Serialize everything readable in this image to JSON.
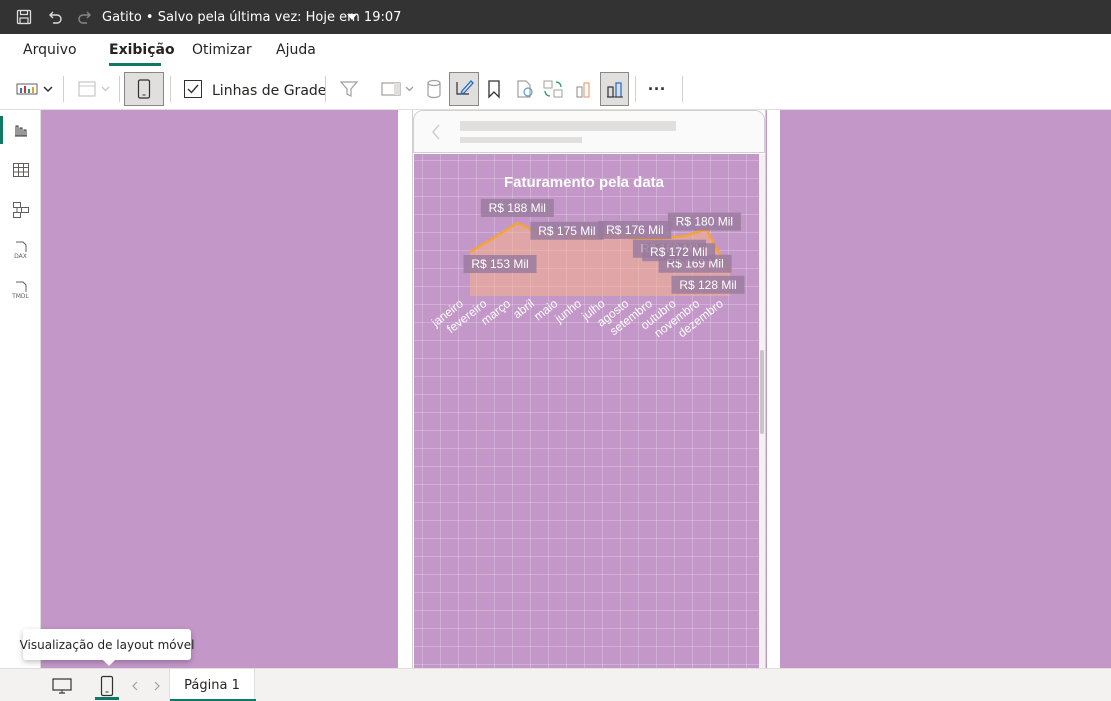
{
  "titlebar": {
    "title": "Gatito • Salvo pela última vez: Hoje em 19:07",
    "icons": [
      "save-icon",
      "undo-icon",
      "redo-icon",
      "dropdown-caret-icon"
    ]
  },
  "menu": {
    "items": [
      "Arquivo",
      "Exibição",
      "Otimizar",
      "Ajuda"
    ],
    "active": "Exibição"
  },
  "toolbar": {
    "gridlines_label": "Linhas de Grade",
    "gridlines_checked": true,
    "more_label": "···"
  },
  "left_rail": {
    "items": [
      "report-view-icon",
      "table-view-icon",
      "model-view-icon",
      "dax-query-icon",
      "tmdl-view-icon"
    ],
    "dax_label": "DAX",
    "tmdl_label": "TMDL"
  },
  "bottombar": {
    "page_tab": "Página 1",
    "tooltip": "Visualização de layout móvel"
  },
  "colors": {
    "canvas": "#c497c9",
    "accent": "#117865",
    "line": "#f2a33a",
    "area": "#f7b38a",
    "label_bg": "#9a7b9e"
  },
  "chart_data": {
    "type": "area",
    "title": "Faturamento pela data",
    "categories": [
      "janeiro",
      "fevereiro",
      "março",
      "abril",
      "maio",
      "junho",
      "julho",
      "agosto",
      "setembro",
      "outubro",
      "novembro",
      "dezembro"
    ],
    "series": [
      {
        "values": [
          153,
          170,
          188,
          175,
          176,
          169,
          176,
          169,
          169,
          172,
          180,
          128
        ],
        "labels": [
          "R$ 153 Mil",
          null,
          "R$ 188 Mil",
          "R$ 175 Mil",
          null,
          null,
          "R$ 176 Mil",
          "R$ 169 Mil",
          "R$ 169 Mil",
          "R$ 172 Mil",
          "R$ 180 Mil",
          "R$ 128 Mil"
        ]
      }
    ],
    "xlabel": "",
    "ylabel": "",
    "grid": true
  }
}
